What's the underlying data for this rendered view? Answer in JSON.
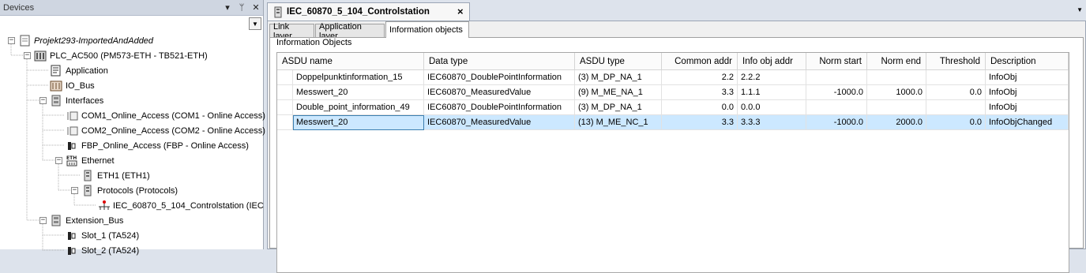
{
  "devices": {
    "title": "Devices",
    "pin_label": "▾",
    "autohide_label": "ᛘ",
    "close_label": "✕",
    "tree": [
      {
        "label": "Projekt293-ImportedAndAdded",
        "italic": true,
        "icon": "project-file-icon",
        "expander": "−"
      },
      {
        "label": "PLC_AC500 (PM573-ETH - TB521-ETH)",
        "icon": "plc-icon",
        "expander": "−"
      },
      {
        "label": "Application",
        "icon": "application-icon"
      },
      {
        "label": "IO_Bus",
        "icon": "io-bus-icon"
      },
      {
        "label": "Interfaces",
        "icon": "interfaces-icon",
        "expander": "−"
      },
      {
        "label": "COM1_Online_Access (COM1 - Online Access)",
        "icon": "serial-port-icon"
      },
      {
        "label": "COM2_Online_Access (COM2 - Online Access)",
        "icon": "serial-port-icon"
      },
      {
        "label": "FBP_Online_Access (FBP - Online Access)",
        "icon": "fbp-icon"
      },
      {
        "label": "Ethernet",
        "icon": "ethernet-icon",
        "expander": "−"
      },
      {
        "label": "ETH1 (ETH1)",
        "icon": "eth-port-icon"
      },
      {
        "label": "Protocols (Protocols)",
        "icon": "protocols-icon",
        "expander": "−"
      },
      {
        "label": "IEC_60870_5_104_Controlstation (IEC",
        "icon": "network-node-icon"
      },
      {
        "label": "Extension_Bus",
        "icon": "extension-bus-icon",
        "expander": "−"
      },
      {
        "label": "Slot_1 (TA524)",
        "icon": "slot-icon"
      },
      {
        "label": "Slot_2 (TA524)",
        "icon": "slot-icon"
      }
    ]
  },
  "editor": {
    "doc_tab": "IEC_60870_5_104_Controlstation",
    "doc_tab_close": "×",
    "tab_menu": "▼",
    "sub_tabs": [
      "Link layer",
      "Application layer",
      "Information objects"
    ],
    "group_title": "Information Objects",
    "columns": [
      "ASDU name",
      "Data type",
      "ASDU type",
      "Common addr",
      "Info obj addr",
      "Norm start",
      "Norm end",
      "Threshold",
      "Description"
    ],
    "rows": [
      [
        "Doppelpunktinformation_15",
        "IEC60870_DoublePointInformation",
        "(3) M_DP_NA_1",
        "2.2",
        "2.2.2",
        "",
        "",
        "",
        "InfoObj"
      ],
      [
        "Messwert_20",
        "IEC60870_MeasuredValue",
        "(9) M_ME_NA_1",
        "3.3",
        "1.1.1",
        "-1000.0",
        "1000.0",
        "0.0",
        "InfoObj"
      ],
      [
        "Double_point_information_49",
        "IEC60870_DoublePointInformation",
        "(3) M_DP_NA_1",
        "0.0",
        "0.0.0",
        "",
        "",
        "",
        "InfoObj"
      ],
      [
        "Messwert_20",
        "IEC60870_MeasuredValue",
        "(13) M_ME_NC_1",
        "3.3",
        "3.3.3",
        "-1000.0",
        "2000.0",
        "0.0",
        "InfoObjChanged"
      ]
    ],
    "selected_row": 3
  }
}
